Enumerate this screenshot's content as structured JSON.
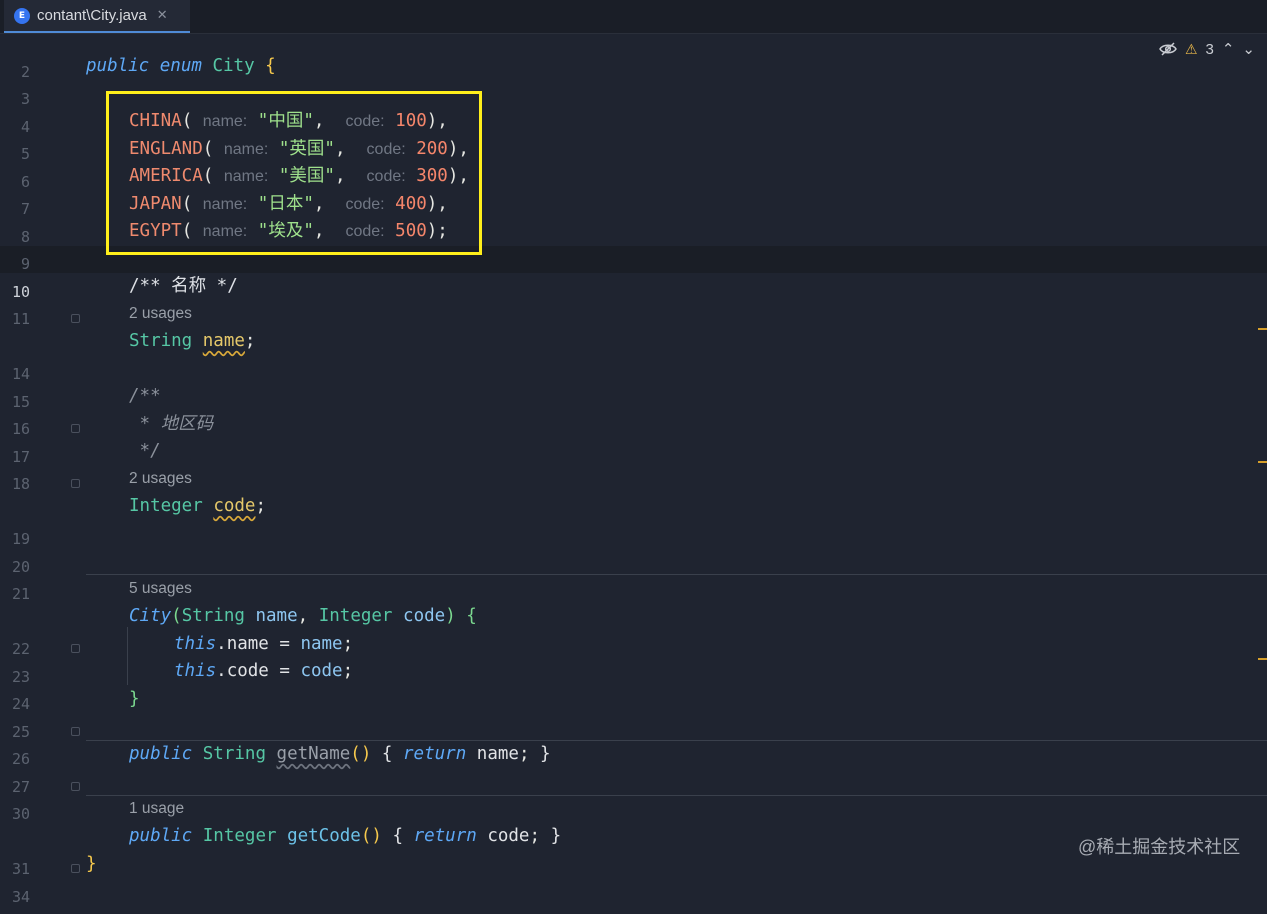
{
  "tab": {
    "icon_letter": "E",
    "label": "contant\\City.java",
    "close_glyph": "✕"
  },
  "inspections": {
    "eye_icon": "eye-off-icon",
    "warning_count": "3",
    "warning_glyph": "⚠",
    "up": "⌃",
    "down": "⌄"
  },
  "gutter": [
    "2",
    "3",
    "4",
    "5",
    "6",
    "7",
    "8",
    "9",
    "10",
    "11",
    "14",
    "15",
    "16",
    "17",
    "18",
    "19",
    "20",
    "21",
    "22",
    "23",
    "24",
    "25",
    "26",
    "27",
    "30",
    "31",
    "34"
  ],
  "code": {
    "l3": {
      "kw1": "public",
      "kw2": "enum",
      "type": "City",
      "brace": "{"
    },
    "enums": [
      {
        "name": "CHINA",
        "hint1": "name:",
        "str": "\"中国\"",
        "hint2": "code:",
        "num": "100",
        "end": "),"
      },
      {
        "name": "ENGLAND",
        "hint1": "name:",
        "str": "\"英国\"",
        "hint2": "code:",
        "num": "200",
        "end": "),"
      },
      {
        "name": "AMERICA",
        "hint1": "name:",
        "str": "\"美国\"",
        "hint2": "code:",
        "num": "300",
        "end": "),"
      },
      {
        "name": "JAPAN",
        "hint1": "name:",
        "str": "\"日本\"",
        "hint2": "code:",
        "num": "400",
        "end": "),"
      },
      {
        "name": "EGYPT",
        "hint1": "name:",
        "str": "\"埃及\"",
        "hint2": "code:",
        "num": "500",
        "end": ");"
      }
    ],
    "l11": "/** 名称 */",
    "usage_name": "2 usages",
    "l14": {
      "type": "String",
      "field": "name",
      "semi": ";"
    },
    "l16": "/**",
    "l17": " * 地区码",
    "l18": " */",
    "usage_code": "2 usages",
    "l19": {
      "type": "Integer",
      "field": "code",
      "semi": ";"
    },
    "usage_ctor": "5 usages",
    "l22": {
      "ctor": "City",
      "p_open": "(",
      "t1": "String",
      "a1": "name",
      "comma": ",",
      "t2": "Integer",
      "a2": "code",
      "p_close": ")",
      "brace": "{"
    },
    "l23": {
      "kw": "this",
      "rest": ".name = ",
      "ref": "name",
      "semi": ";"
    },
    "l24": {
      "kw": "this",
      "rest": ".code = ",
      "ref": "code",
      "semi": ";"
    },
    "l25": "}",
    "l27": {
      "kw": "public",
      "type": "String",
      "method": "getName",
      "parens": "()",
      "open": "{",
      "ret": "return",
      "ref": "name",
      "semi": ";",
      "close": "}"
    },
    "usage_getcode": "1 usage",
    "l31": {
      "kw": "public",
      "type": "Integer",
      "method": "getCode",
      "parens": "()",
      "open": "{",
      "ret": "return",
      "ref": "code",
      "semi": ";",
      "close": "}"
    },
    "l34": "}"
  },
  "watermark": "@稀土掘金技术社区",
  "colors": {
    "background": "#1f2430",
    "highlight_box": "#ffef1b",
    "tab_accent": "#4f8bd6"
  }
}
